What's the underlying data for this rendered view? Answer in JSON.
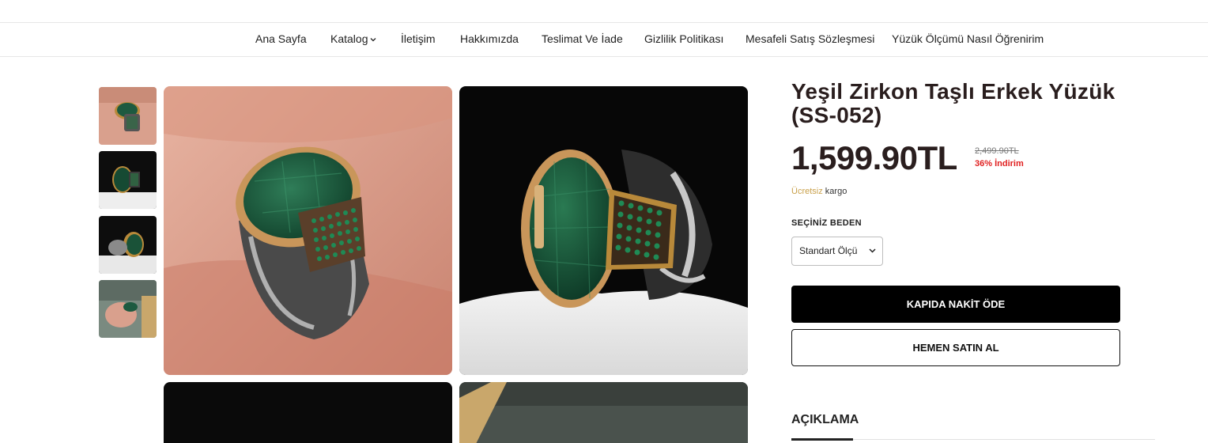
{
  "nav": {
    "items": [
      {
        "label": "Ana Sayfa"
      },
      {
        "label": "Katalog"
      },
      {
        "label": "İletişim"
      },
      {
        "label": "Hakkımızda"
      },
      {
        "label": "Teslimat Ve İade"
      },
      {
        "label": "Gizlilik Politikası"
      },
      {
        "label": "Mesafeli Satış Sözleşmesi"
      },
      {
        "label": "Yüzük Ölçümü Nasıl Öğrenirim"
      }
    ]
  },
  "product": {
    "title": "Yeşil Zirkon Taşlı Erkek Yüzük (SS-052)",
    "price": "1,599.90TL",
    "old_price": "2,499.90TL",
    "discount": "36% İndirim",
    "shipping_free": "Ücretsiz",
    "shipping_text": " kargo",
    "size_label": "SEÇİNİZ BEDEN",
    "size_selected": "Standart Ölçü",
    "cod_button": "KAPIDA NAKİT ÖDE",
    "buy_button": "HEMEN SATIN AL",
    "description_tab": "AÇIKLAMA"
  },
  "colors": {
    "accent_gold": "#c9a04a",
    "discount_red": "#e02020",
    "primary_black": "#000000"
  },
  "icons": {
    "katalog_dropdown": "chevron-down-icon",
    "size_dropdown": "chevron-down-icon"
  }
}
